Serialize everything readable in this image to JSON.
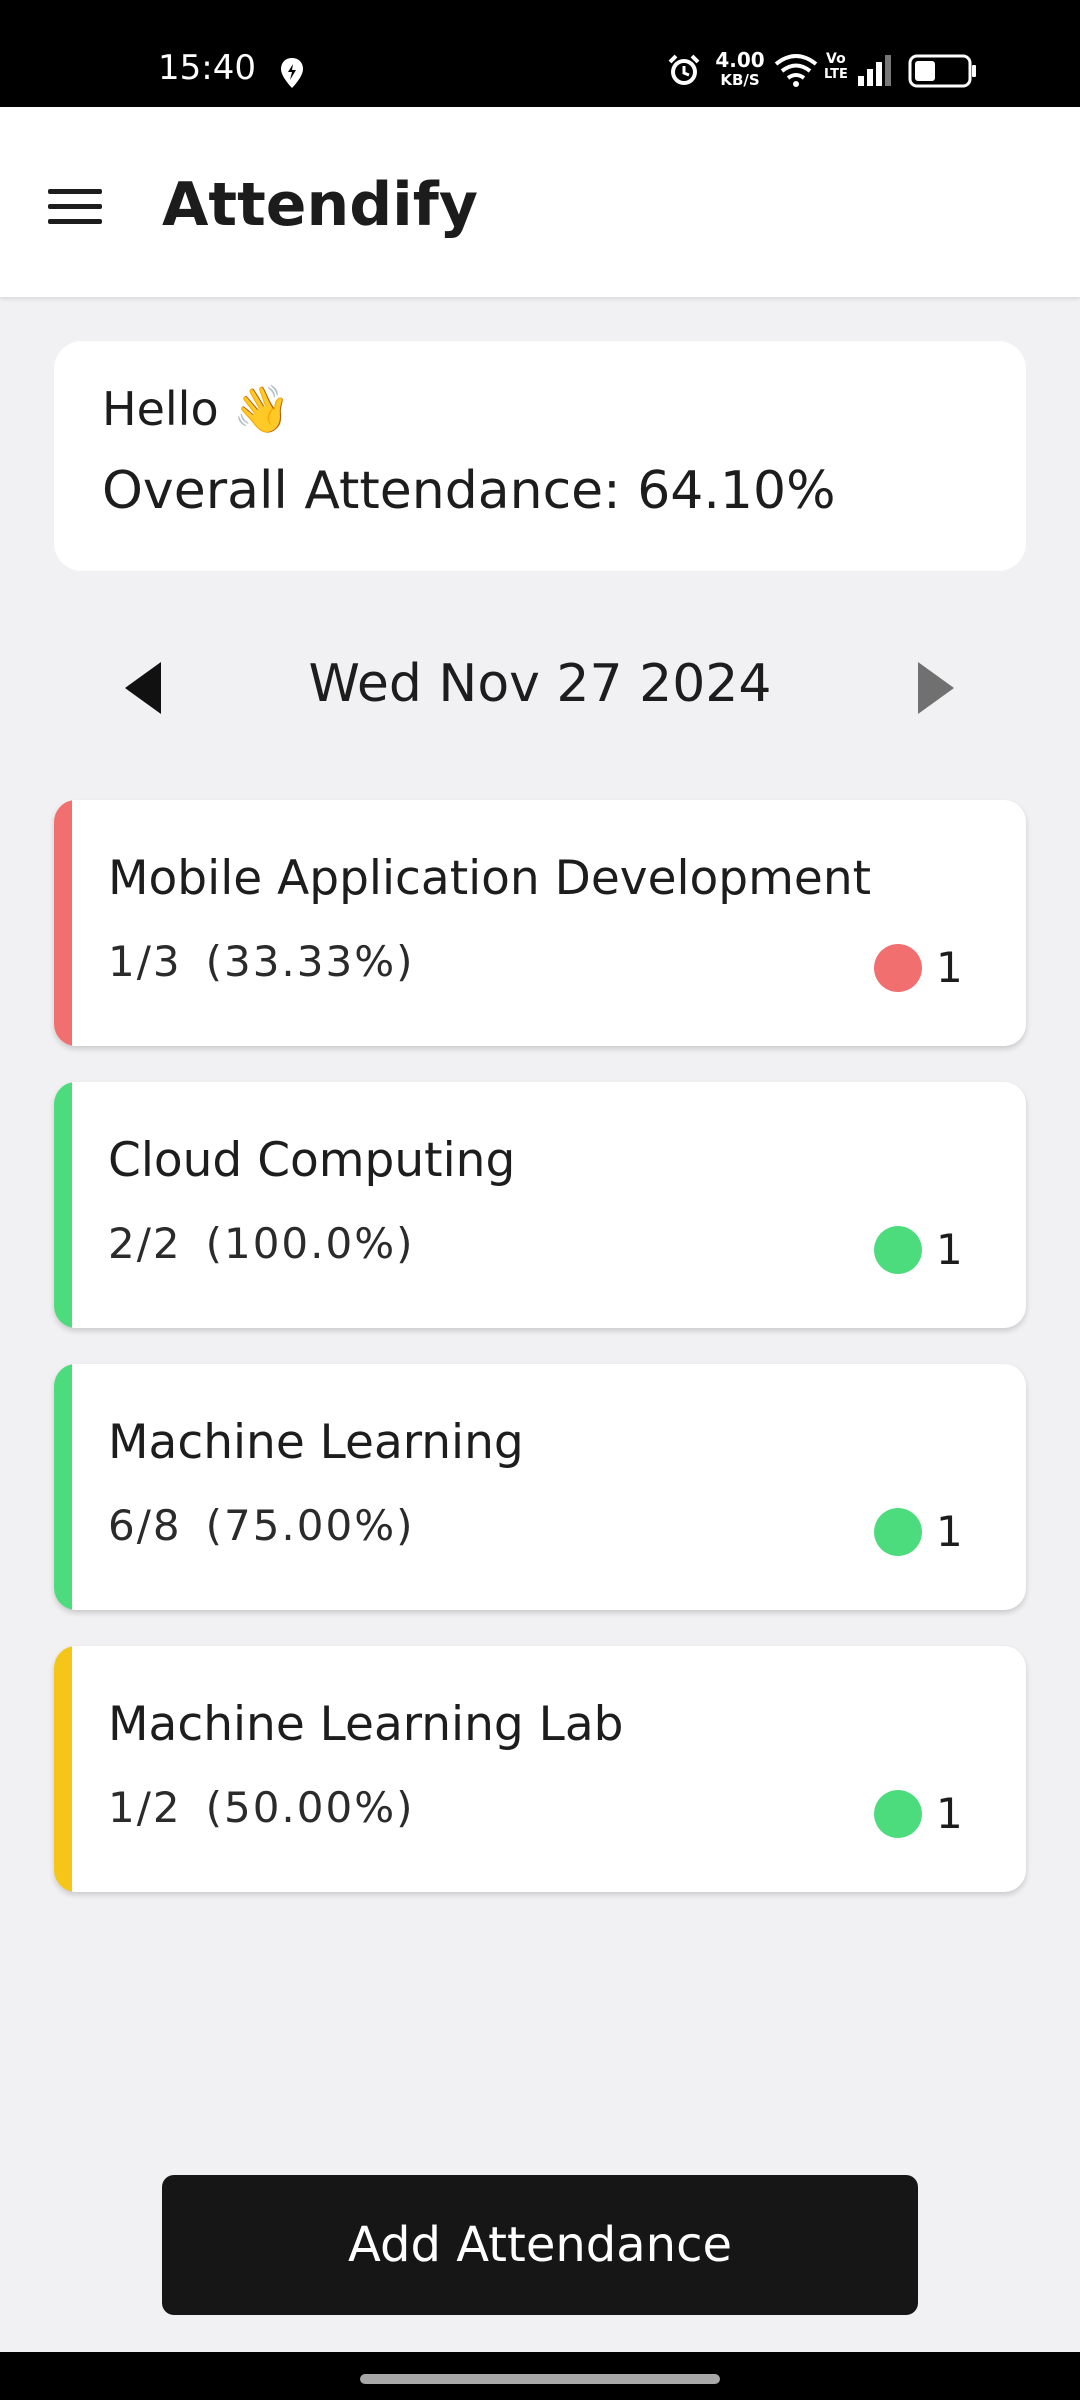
{
  "status_bar": {
    "time": "15:40",
    "net_speed_value": "4.00",
    "net_speed_unit": "KB/S",
    "volte_top": "Vo",
    "volte_bottom": "LTE",
    "icons": [
      "location-icon",
      "alarm-icon",
      "wifi-icon",
      "signal-icon",
      "battery-icon"
    ]
  },
  "app_bar": {
    "title": "Attendify",
    "menu_icon": "hamburger-menu-icon"
  },
  "greeting": {
    "hello": "Hello",
    "wave_emoji": "👋",
    "overall_attendance": "Overall Attendance: 64.10%"
  },
  "date_nav": {
    "date": "Wed Nov 27 2024",
    "prev_icon": "caret-left-icon",
    "next_icon": "caret-right-icon"
  },
  "courses": [
    {
      "name": "Mobile Application Development",
      "ratio": "1/3",
      "percent": "(33.33%)",
      "count": "1",
      "accent_color": "#f26f70",
      "status_color": "#f26f70"
    },
    {
      "name": "Cloud Computing",
      "ratio": "2/2",
      "percent": "(100.0%)",
      "count": "1",
      "accent_color": "#4ddc7d",
      "status_color": "#4ddc7d"
    },
    {
      "name": "Machine Learning",
      "ratio": "6/8",
      "percent": "(75.00%)",
      "count": "1",
      "accent_color": "#4ddc7d",
      "status_color": "#4ddc7d"
    },
    {
      "name": "Machine Learning Lab",
      "ratio": "1/2",
      "percent": "(50.00%)",
      "count": "1",
      "accent_color": "#f5c518",
      "status_color": "#4ddc7d"
    }
  ],
  "actions": {
    "add_attendance": "Add Attendance"
  }
}
